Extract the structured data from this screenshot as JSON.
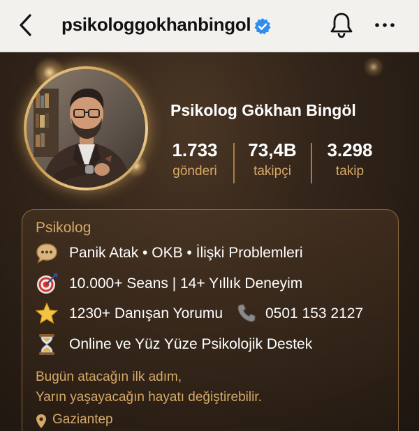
{
  "header": {
    "username": "psikologgokhanbingol",
    "verified": true,
    "icons": [
      "back-chevron-icon",
      "verified-badge-icon",
      "bell-icon",
      "more-horizontal-icon"
    ]
  },
  "profile": {
    "display_name": "Psikolog Gökhan Bingöl",
    "stats": [
      {
        "value": "1.733",
        "label": "gönderi"
      },
      {
        "value": "73,4B",
        "label": "takipçi"
      },
      {
        "value": "3.298",
        "label": "takip"
      }
    ]
  },
  "bio": {
    "category": "Psikolog",
    "lines": [
      {
        "icon": "speech-bubble-icon",
        "text": "Panik Atak • OKB • İlişki Problemleri"
      },
      {
        "icon": "target-icon",
        "text": "10.000+ Seans | 14+ Yıllık Deneyim"
      },
      {
        "icon": "star-icon",
        "text": "1230+ Danışan Yorumu",
        "extra_icon": "phone-icon",
        "extra_text": "0501 153 2127"
      },
      {
        "icon": "hourglass-icon",
        "text": "Online ve Yüz Yüze Psikolojik Destek"
      }
    ],
    "tagline": [
      "Bugün atacağın ilk adım,",
      "Yarın yaşayacağın hayatı değiştirebilir."
    ],
    "location": "Gaziantep"
  },
  "colors": {
    "accent_gold": "#d7a968",
    "verified_blue": "#2f8cf0",
    "background_dark": "#2a1e14"
  }
}
